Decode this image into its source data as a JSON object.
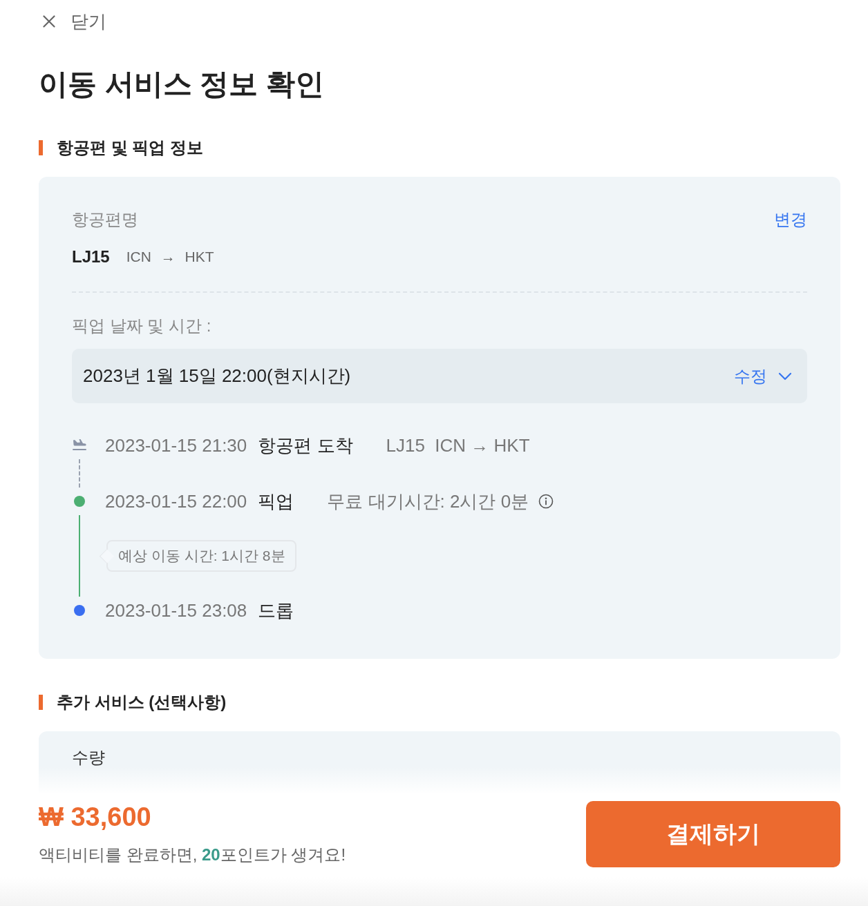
{
  "close_button": {
    "label": "닫기"
  },
  "title": "이동 서비스 정보 확인",
  "flight_section": {
    "heading": "항공편 및 픽업 정보",
    "flight_label": "항공편명",
    "change_link": "변경",
    "flight_number": "LJ15",
    "route": "ICN → HKT",
    "pickup_label": "픽업 날짜 및 시간 :",
    "pickup_field": {
      "value": "2023년 1월 15일 22:00(현지시간)",
      "edit_label": "수정"
    },
    "timeline": [
      {
        "kind": "arrival",
        "time": "2023-01-15 21:30",
        "event": "항공편 도착",
        "detail": "LJ15  ICN → HKT"
      },
      {
        "kind": "pickup",
        "time": "2023-01-15 22:00",
        "event": "픽업",
        "detail": "무료 대기시간: 2시간 0분",
        "color": "#4caf72",
        "note": "예상 이동 시간: 1시간 8분"
      },
      {
        "kind": "drop",
        "time": "2023-01-15 23:08",
        "event": "드롭",
        "color": "#3a6ef0"
      }
    ]
  },
  "extras_section": {
    "heading": "추가 서비스 (선택사항)",
    "quantity_label": "수량"
  },
  "footer": {
    "price": "₩ 33,600",
    "reward_note": "액티비티를 완료하면, **20**포인트가 생겨요!",
    "pay_button": "결제하기"
  }
}
